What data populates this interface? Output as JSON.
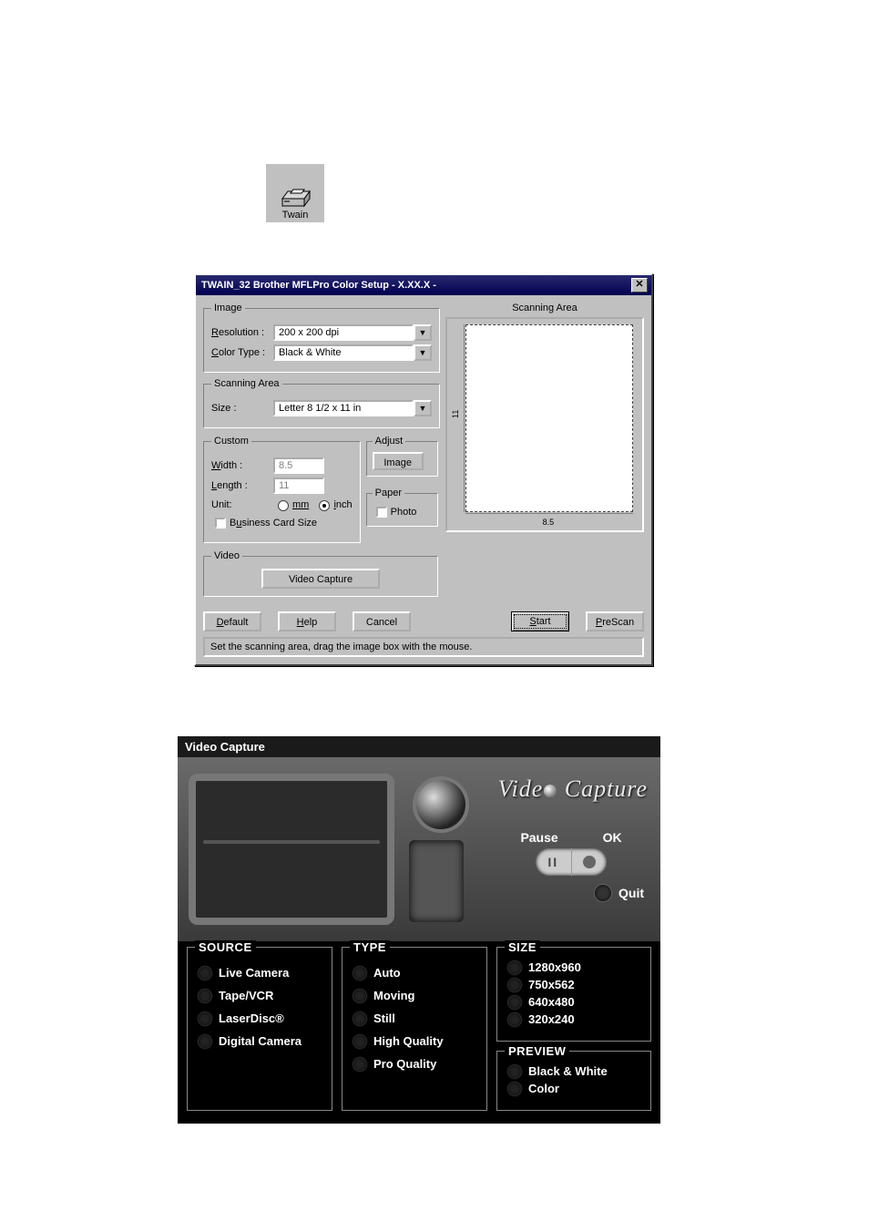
{
  "twain_icon": {
    "label": "Twain"
  },
  "dialog": {
    "title": "TWAIN_32 Brother MFLPro Color Setup - X.XX.X -",
    "image_group": "Image",
    "resolution_label": "Resolution :",
    "resolution_value": "200 x 200 dpi",
    "color_label": "Color Type :",
    "color_value": "Black & White",
    "scanarea_group": "Scanning Area",
    "size_label": "Size :",
    "size_value": "Letter 8 1/2 x 11 in",
    "custom_group": "Custom",
    "width_label": "Width :",
    "width_value": "8.5",
    "length_label": "Length :",
    "length_value": "11",
    "unit_label": "Unit:",
    "unit_mm": "mm",
    "unit_inch": "inch",
    "bizcard_label": "Business Card Size",
    "adjust_group": "Adjust",
    "adjust_button": "Image",
    "paper_group": "Paper",
    "photo_label": "Photo",
    "video_group": "Video",
    "video_button": "Video Capture",
    "scanning_area_title": "Scanning Area",
    "ruler_h": "8.5",
    "ruler_v": "11",
    "btn_default": "Default",
    "btn_help": "Help",
    "btn_cancel": "Cancel",
    "btn_start": "Start",
    "btn_prescan": "PreScan",
    "status": "Set the scanning area, drag the image box with the mouse."
  },
  "video": {
    "title": "Video Capture",
    "logo_left": "Vide",
    "logo_right": " Capture",
    "pause": "Pause",
    "ok": "OK",
    "quit": "Quit",
    "source_label": "SOURCE",
    "source": [
      "Live Camera",
      "Tape/VCR",
      "LaserDisc®",
      "Digital Camera"
    ],
    "type_label": "TYPE",
    "type": [
      "Auto",
      "Moving",
      "Still",
      "High Quality",
      "Pro Quality"
    ],
    "size_label": "SIZE",
    "size": [
      "1280x960",
      "750x562",
      "640x480",
      "320x240"
    ],
    "preview_label": "PREVIEW",
    "preview": [
      "Black & White",
      "Color"
    ]
  }
}
